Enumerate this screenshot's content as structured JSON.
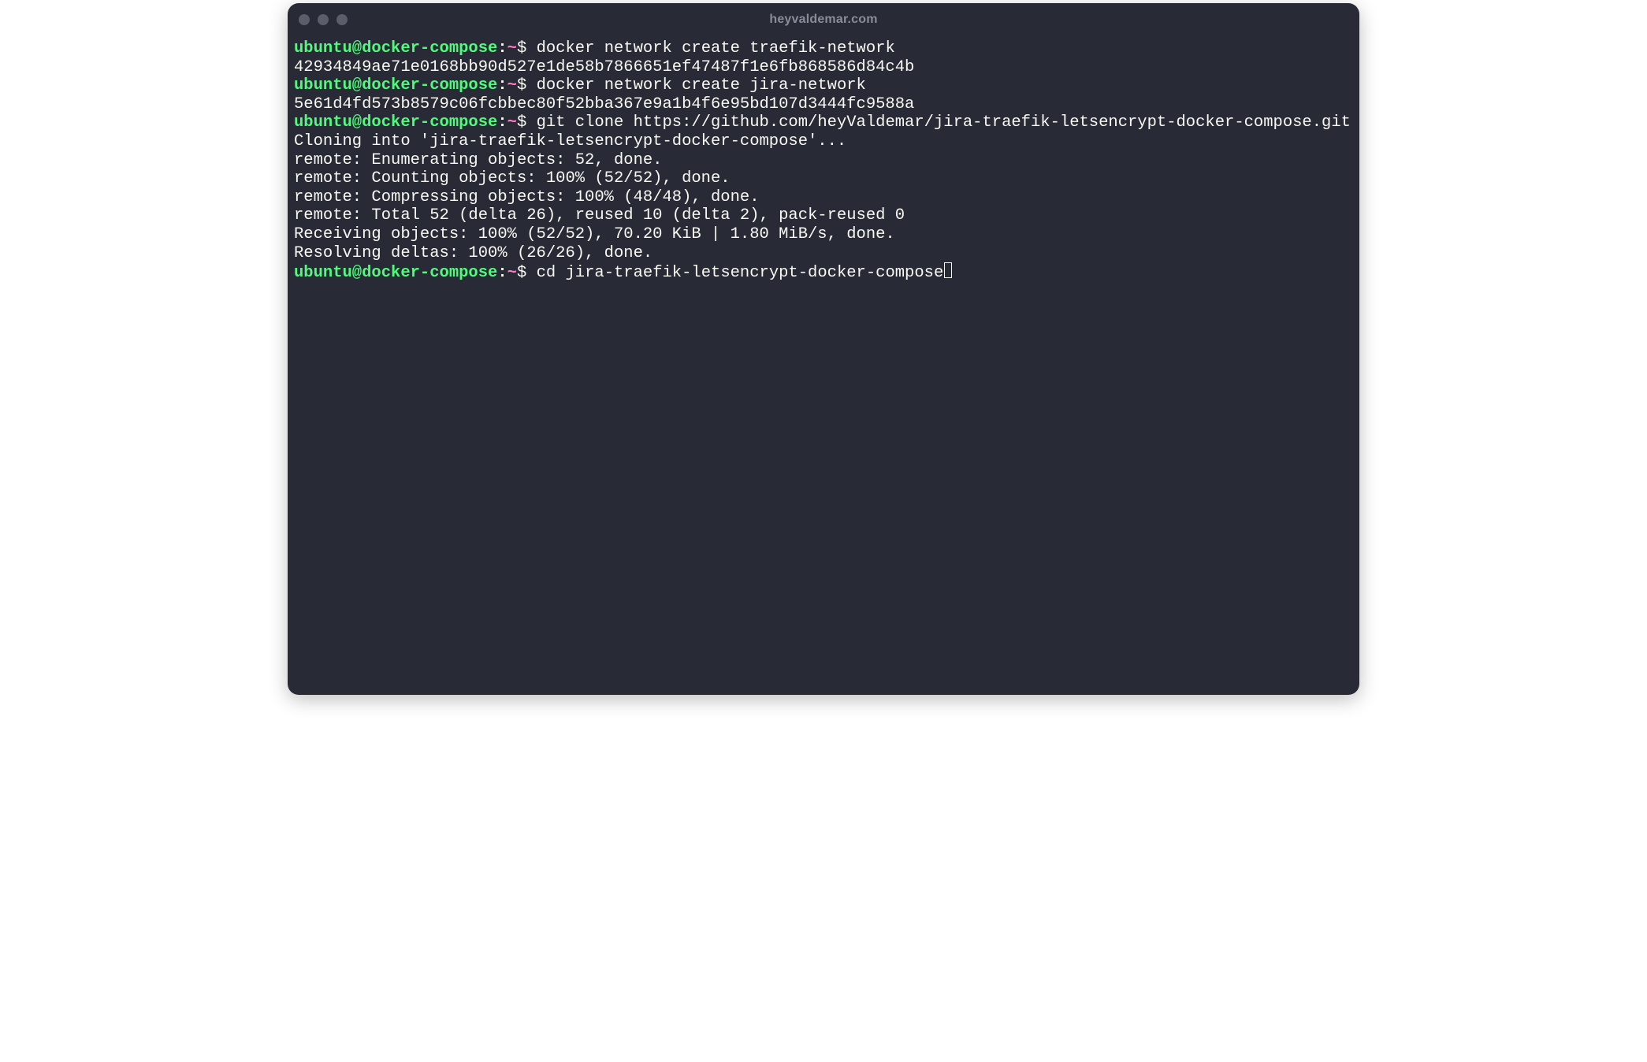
{
  "window": {
    "title": "heyvaldemar.com"
  },
  "prompt": {
    "userhost": "ubuntu@docker-compose",
    "colon": ":",
    "tilde": "~",
    "dollar": "$"
  },
  "lines": [
    {
      "type": "prompt",
      "cmd": "docker network create traefik-network"
    },
    {
      "type": "output",
      "text": "42934849ae71e0168bb90d527e1de58b7866651ef47487f1e6fb868586d84c4b"
    },
    {
      "type": "prompt",
      "cmd": "docker network create jira-network"
    },
    {
      "type": "output",
      "text": "5e61d4fd573b8579c06fcbbec80f52bba367e9a1b4f6e95bd107d3444fc9588a"
    },
    {
      "type": "prompt",
      "cmd": "git clone https://github.com/heyValdemar/jira-traefik-letsencrypt-docker-compose.git"
    },
    {
      "type": "output",
      "text": "Cloning into 'jira-traefik-letsencrypt-docker-compose'..."
    },
    {
      "type": "output",
      "text": "remote: Enumerating objects: 52, done."
    },
    {
      "type": "output",
      "text": "remote: Counting objects: 100% (52/52), done."
    },
    {
      "type": "output",
      "text": "remote: Compressing objects: 100% (48/48), done."
    },
    {
      "type": "output",
      "text": "remote: Total 52 (delta 26), reused 10 (delta 2), pack-reused 0"
    },
    {
      "type": "output",
      "text": "Receiving objects: 100% (52/52), 70.20 KiB | 1.80 MiB/s, done."
    },
    {
      "type": "output",
      "text": "Resolving deltas: 100% (26/26), done."
    },
    {
      "type": "prompt",
      "cmd": "cd jira-traefik-letsencrypt-docker-compose",
      "cursor": true
    }
  ]
}
